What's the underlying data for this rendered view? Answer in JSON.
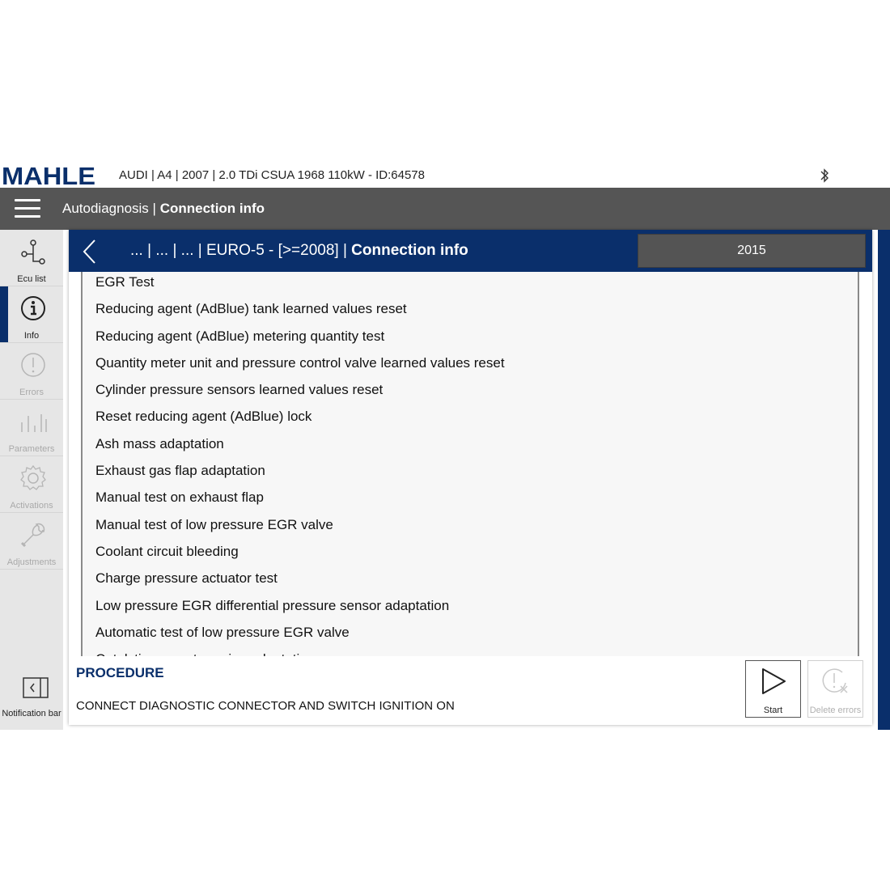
{
  "brand": {
    "logo_text": "MAHLE",
    "color": "#0a2f6b"
  },
  "header": {
    "vehicle": "AUDI | A4 | 2007 | 2.0 TDi CSUA 1968 110kW - ID:64578"
  },
  "navbar": {
    "section": "Autodiagnosis",
    "separator": " | ",
    "page": "Connection info"
  },
  "sidebar": {
    "items": [
      {
        "label": "Ecu list",
        "icon": "ecu-tree-icon",
        "state": "enabled"
      },
      {
        "label": "Info",
        "icon": "info-icon",
        "state": "active"
      },
      {
        "label": "Errors",
        "icon": "warning-icon",
        "state": "disabled"
      },
      {
        "label": "Parameters",
        "icon": "bars-icon",
        "state": "disabled"
      },
      {
        "label": "Activations",
        "icon": "gear-icon",
        "state": "disabled"
      },
      {
        "label": "Adjustments",
        "icon": "wrench-icon",
        "state": "disabled"
      }
    ],
    "notification": {
      "label": "Notification bar",
      "icon": "panel-collapse-icon"
    }
  },
  "panel": {
    "breadcrumb_path": "... | ... | ... | EURO-5 - [>=2008] | ",
    "breadcrumb_current": "Connection info",
    "year": "2015",
    "items": [
      "EGR Test",
      "Reducing agent (AdBlue) tank learned values reset",
      "Reducing agent (AdBlue) metering quantity test",
      "Quantity meter unit and pressure control valve learned values reset",
      "Cylinder pressure sensors learned values reset",
      "Reset reducing agent (AdBlue) lock",
      "Ash mass adaptation",
      "Exhaust gas flap adaptation",
      "Manual test on exhaust flap",
      "Manual test of low pressure EGR valve",
      "Coolant circuit bleeding",
      "Charge pressure actuator test",
      "Low pressure EGR differential pressure sensor adaptation",
      "Automatic test of low pressure EGR valve",
      "Catalytic converter aging adaptation"
    ]
  },
  "procedure": {
    "title": "PROCEDURE",
    "text": "CONNECT DIAGNOSTIC CONNECTOR AND SWITCH IGNITION ON",
    "start_label": "Start",
    "delete_label": "Delete errors"
  }
}
